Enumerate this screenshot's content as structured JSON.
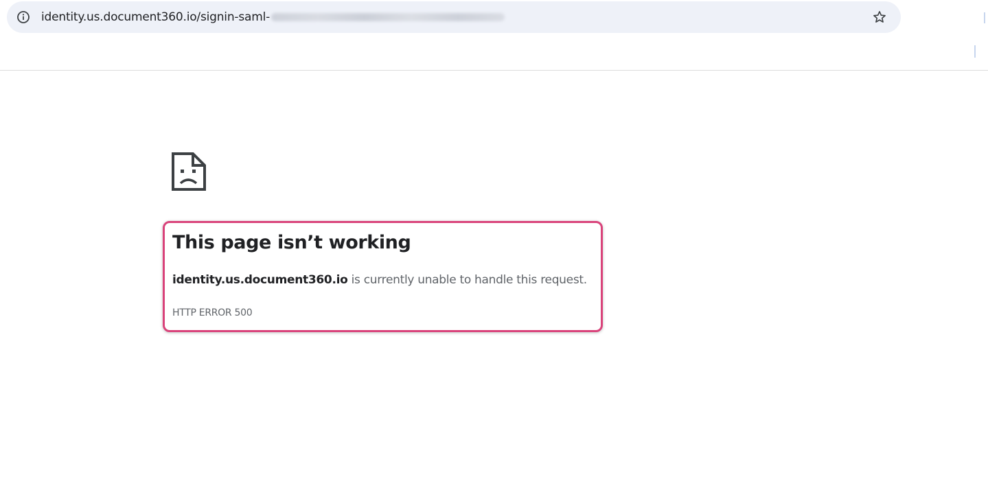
{
  "browser": {
    "url_visible": "identity.us.document360.io/signin-saml-",
    "icons": {
      "site_info": "info-icon",
      "bookmark": "star-icon"
    }
  },
  "error_page": {
    "icon": "sad-page-icon",
    "title": "This page isn’t working",
    "host": "identity.us.document360.io",
    "message_rest": " is currently unable to handle this request.",
    "error_code": "HTTP ERROR 500"
  },
  "colors": {
    "highlight_border": "#d9427a",
    "omnibox_bg": "#eef1f8"
  }
}
